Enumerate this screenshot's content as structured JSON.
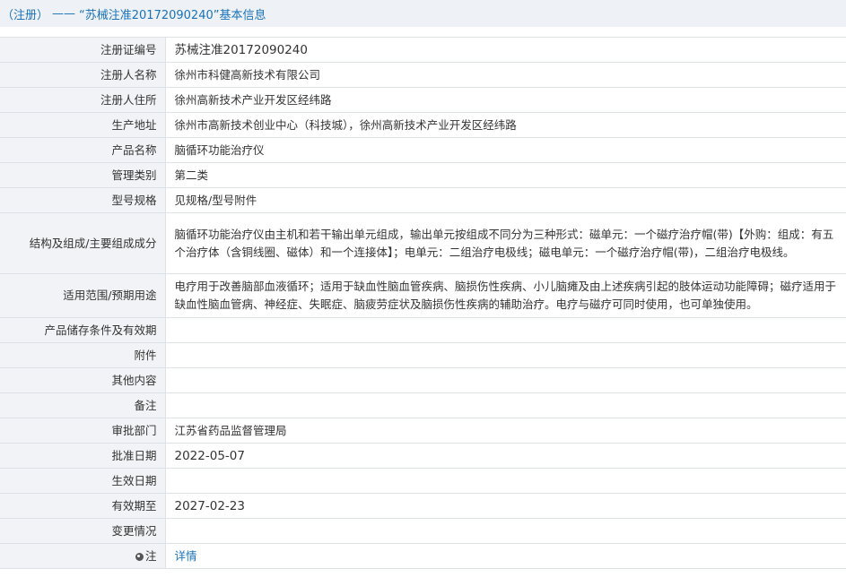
{
  "header": {
    "prefix": "（注册）",
    "dash": "——",
    "title": "“苏械注准20172090240”基本信息"
  },
  "rows": [
    {
      "label": "注册证编号",
      "value": "苏械注准20172090240"
    },
    {
      "label": "注册人名称",
      "value": "徐州市科健高新技术有限公司"
    },
    {
      "label": "注册人住所",
      "value": "徐州高新技术产业开发区经纬路"
    },
    {
      "label": "生产地址",
      "value": "徐州市高新技术创业中心（科技城），徐州高新技术产业开发区经纬路"
    },
    {
      "label": "产品名称",
      "value": "脑循环功能治疗仪"
    },
    {
      "label": "管理类别",
      "value": "第二类"
    },
    {
      "label": "型号规格",
      "value": "见规格/型号附件"
    },
    {
      "label": "结构及组成/主要组成成分",
      "value": "脑循环功能治疗仪由主机和若干输出单元组成，输出单元按组成不同分为三种形式：磁单元：一个磁疗治疗帽(带)【外购：组成：有五个治疗体（含铜线圈、磁体）和一个连接体】；电单元：二组治疗电极线；磁电单元：一个磁疗治疗帽(带)，二组治疗电极线。"
    },
    {
      "label": "适用范围/预期用途",
      "value": "电疗用于改善脑部血液循环；适用于缺血性脑血管疾病、脑损伤性疾病、小儿脑瘫及由上述疾病引起的肢体运动功能障碍；磁疗适用于缺血性脑血管病、神经症、失眠症、脑疲劳症状及脑损伤性疾病的辅助治疗。电疗与磁疗可同时使用，也可单独使用。"
    },
    {
      "label": "产品储存条件及有效期",
      "value": ""
    },
    {
      "label": "附件",
      "value": ""
    },
    {
      "label": "其他内容",
      "value": ""
    },
    {
      "label": "备注",
      "value": ""
    },
    {
      "label": "审批部门",
      "value": "江苏省药品监督管理局"
    },
    {
      "label": "批准日期",
      "value": "2022-05-07"
    },
    {
      "label": "生效日期",
      "value": ""
    },
    {
      "label": "有效期至",
      "value": "2027-02-23"
    },
    {
      "label": "变更情况",
      "value": ""
    }
  ],
  "note": {
    "label": "注",
    "icon": "info-pin-icon",
    "link_text": "详情"
  },
  "colors": {
    "accent": "#1a73b8",
    "header_bg": "#eef1f6",
    "label_bg": "#f1f3f6",
    "border": "#dde2ea"
  }
}
